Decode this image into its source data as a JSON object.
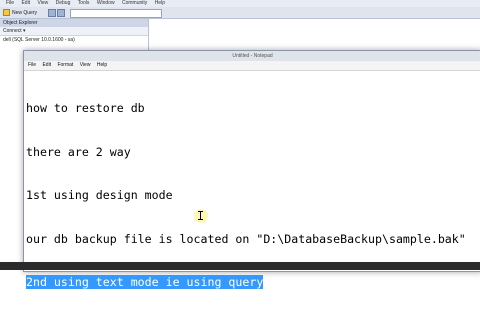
{
  "ssms": {
    "menu": [
      "File",
      "Edit",
      "View",
      "Debug",
      "Tools",
      "Window",
      "Community",
      "Help"
    ],
    "toolbar": {
      "new_query_label": "New Query"
    },
    "object_explorer": {
      "title": "Object Explorer",
      "connect_label": "Connect ▾",
      "server_node": "dell (SQL Server 10.0.1600 - sa)"
    }
  },
  "notepad": {
    "title": "Untitled - Notepad",
    "menu": [
      "File",
      "Edit",
      "Format",
      "View",
      "Help"
    ],
    "lines": [
      "how to restore db",
      "there are 2 way",
      "1st using design mode",
      "our db backup file is located on \"D:\\DatabaseBackup\\sample.bak\"",
      "2nd using text mode ie using query"
    ],
    "selected_line_index": 4
  },
  "colors": {
    "selection": "#3399ff",
    "ssms_chrome": "#d6dbe9"
  }
}
